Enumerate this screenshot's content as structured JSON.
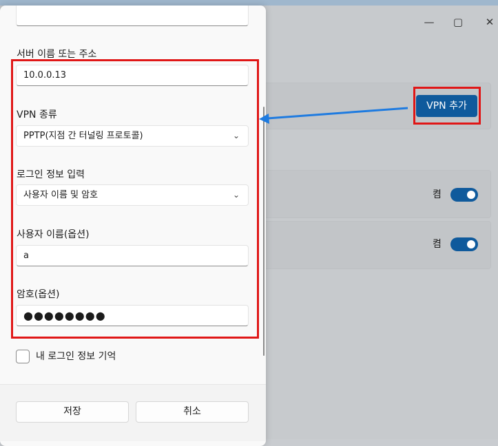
{
  "background_window": {
    "vpn_add_button": "VPN 추가",
    "connections": [
      {
        "toggle_label": "켬",
        "on": true
      },
      {
        "toggle_label": "켬",
        "on": true
      }
    ]
  },
  "dialog": {
    "server_label": "서버 이름 또는 주소",
    "server_value": "10.0.0.13",
    "vpn_type_label": "VPN 종류",
    "vpn_type_value": "PPTP(지점 간 터널링 프로토콜)",
    "signin_label": "로그인 정보 입력",
    "signin_value": "사용자 이름 및 암호",
    "username_label": "사용자 이름(옵션)",
    "username_value": "a",
    "password_label": "암호(옵션)",
    "password_value": "●●●●●●●●",
    "remember_label": "내 로그인 정보 기억",
    "save_button": "저장",
    "cancel_button": "취소"
  },
  "colors": {
    "accent": "#0f5a9c",
    "highlight_box": "#e01616",
    "arrow": "#1e7be0"
  }
}
